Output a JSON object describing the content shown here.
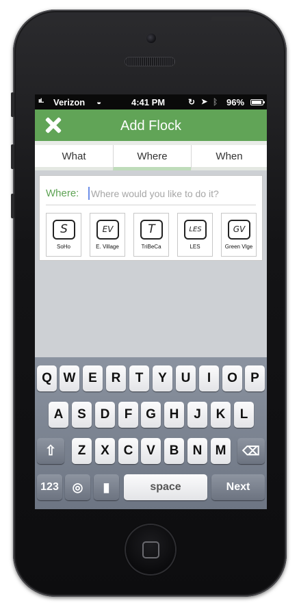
{
  "status_bar": {
    "signal": "ııl..",
    "carrier": "Verizon",
    "wifi_icon": "wifi-icon",
    "time": "4:41 PM",
    "lock_icon": "rotation-lock-icon",
    "location_icon": "location-arrow-icon",
    "bluetooth_icon": "bluetooth-icon",
    "battery": "96%"
  },
  "nav": {
    "title": "Add Flock",
    "close_icon": "close-x-icon",
    "accent_color": "#61a457"
  },
  "tabs": [
    {
      "label": "What",
      "active": false
    },
    {
      "label": "Where",
      "active": true
    },
    {
      "label": "When",
      "active": false
    }
  ],
  "where": {
    "label": "Where:",
    "placeholder": "Where would you like to do it?",
    "value": ""
  },
  "neighborhoods": [
    {
      "badge": "S",
      "name": "SoHo"
    },
    {
      "badge": "EV",
      "name": "E. Village"
    },
    {
      "badge": "T",
      "name": "TriBeCa"
    },
    {
      "badge": "LES",
      "name": "LES"
    },
    {
      "badge": "GV",
      "name": "Green Vlge"
    }
  ],
  "keyboard": {
    "row1": [
      "Q",
      "W",
      "E",
      "R",
      "T",
      "Y",
      "U",
      "I",
      "O",
      "P"
    ],
    "row2": [
      "A",
      "S",
      "D",
      "F",
      "G",
      "H",
      "J",
      "K",
      "L"
    ],
    "row3": [
      "Z",
      "X",
      "C",
      "V",
      "B",
      "N",
      "M"
    ],
    "shift_icon": "shift-icon",
    "delete_icon": "delete-icon",
    "numbers_label": "123",
    "globe_icon": "globe-icon",
    "mic_icon": "microphone-icon",
    "space_label": "space",
    "next_label": "Next"
  }
}
